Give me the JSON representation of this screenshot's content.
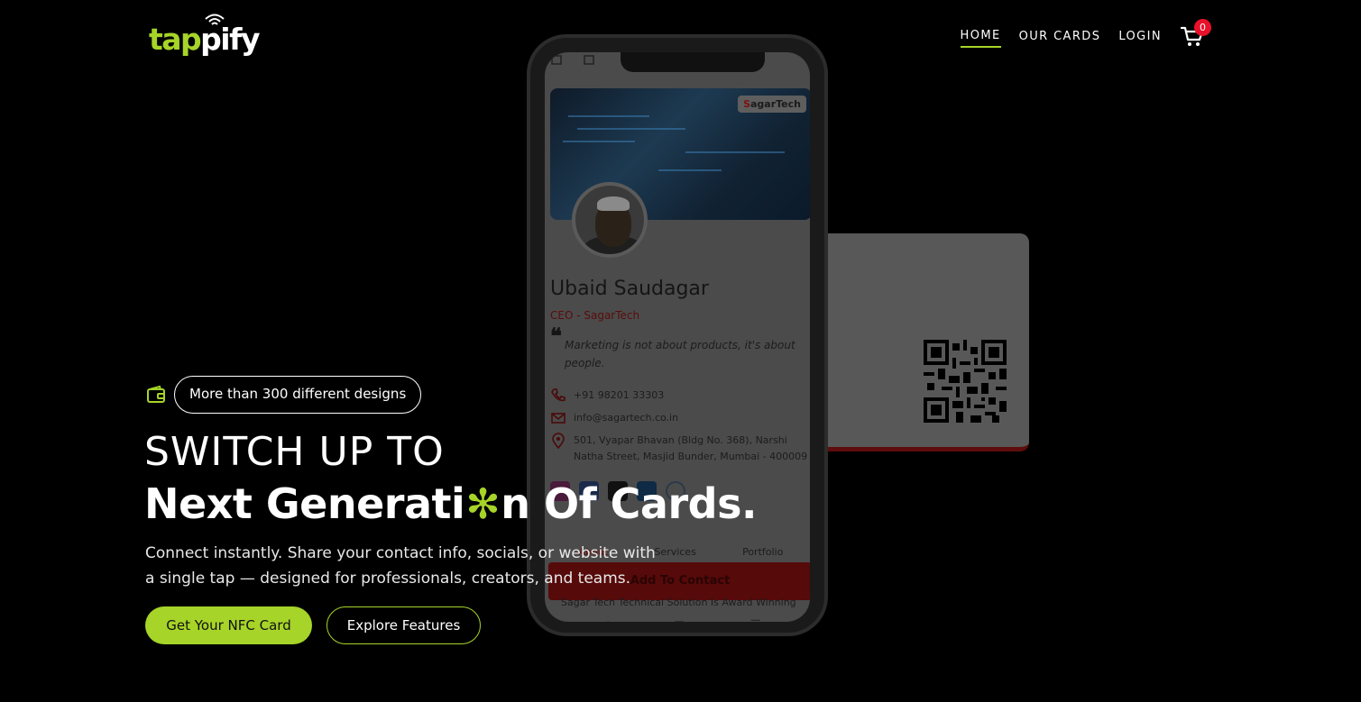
{
  "brand": {
    "logo_accent": "tap",
    "logo_rest": "pify",
    "accent_color": "#a6d428"
  },
  "nav": {
    "items": [
      {
        "label": "HOME",
        "active": true
      },
      {
        "label": "OUR CARDS",
        "active": false
      },
      {
        "label": "LOGIN",
        "active": false
      }
    ],
    "cart_icon": "cart-icon",
    "cart_count": "0"
  },
  "hero": {
    "badge_icon": "wallet-icon",
    "badge_text": "More than 300 different designs",
    "title_line1": "SWITCH UP TO",
    "title_line2_before": "Next Generati",
    "title_line2_glyph": "✻",
    "title_line2_after": "n Of Cards.",
    "subtitle": "Connect instantly. Share your contact info, socials, or website with a single tap — designed for professionals, creators, and teams.",
    "cta_primary": "Get Your NFC Card",
    "cta_secondary": "Explore Features"
  },
  "phone_preview": {
    "brand_prefix": "S",
    "brand_name": "agarTech",
    "name": "Ubaid Saudagar",
    "role": "CEO - SagarTech",
    "quote_mark": "❝",
    "quote": "Marketing is not about products, it's about people.",
    "phone": "+91 98201 33303",
    "email": "info@sagartech.co.in",
    "address": "501, Vyapar Bhavan (Bldg No. 368), Narshi Natha Street, Masjid Bunder, Mumbai - 400009",
    "socials": [
      "instagram-icon",
      "facebook-icon",
      "x-icon",
      "linkedin-icon",
      "globe-icon"
    ],
    "tabs": [
      "About",
      "Services",
      "Portfolio"
    ],
    "add_contact": "Add To Contact",
    "footer_line": "Sagar Tech Technical Solution Is Award Winning",
    "system_nav": [
      "◁",
      "▢",
      "☰"
    ]
  },
  "colors": {
    "background": "#000000",
    "badge_red": "#e8102a",
    "card_red": "#5e0c0c"
  }
}
